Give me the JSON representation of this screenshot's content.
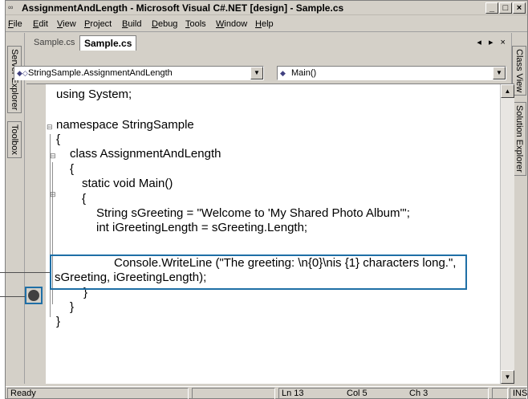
{
  "window": {
    "title": "AssignmentAndLength - Microsoft Visual C#.NET [design] - Sample.cs",
    "controls": [
      "_",
      "□",
      "×"
    ]
  },
  "menu": [
    {
      "label": "File",
      "mnemonic": "F"
    },
    {
      "label": "Edit",
      "mnemonic": "E"
    },
    {
      "label": "View",
      "mnemonic": "V"
    },
    {
      "label": "Project",
      "mnemonic": "P"
    },
    {
      "label": "Build",
      "mnemonic": "B"
    },
    {
      "label": "Debug",
      "mnemonic": "D"
    },
    {
      "label": "Tools",
      "mnemonic": "T"
    },
    {
      "label": "Window",
      "mnemonic": "W"
    },
    {
      "label": "Help",
      "mnemonic": "H"
    }
  ],
  "left_dock": {
    "tabs": [
      "Server Explorer",
      "Toolbox"
    ]
  },
  "right_dock": {
    "tabs": [
      "Class View",
      "Solution Explorer"
    ]
  },
  "doc_tabs": {
    "inactive": "Sample.cs",
    "active": "Sample.cs",
    "nav": "◂ ▸ ×"
  },
  "type_combo": {
    "value": "StringSample.AssignmentAndLength",
    "icon": "class-icon"
  },
  "member_combo": {
    "value": "Main()",
    "icon": "method-icon"
  },
  "code": [
    "using System;",
    "",
    "namespace StringSample",
    "{",
    "class AssignmentAndLength",
    "{",
    "static void Main()",
    "{",
    "String sGreeting = \"Welcome to 'My Shared Photo Album'\";",
    "int iGreetingLength = sGreeting.Length;",
    "",
    "Console.WriteLine (\"The greeting: \\n{0}\\nis {1} characters long.\",",
    "sGreeting, iGreetingLength);",
    "}",
    "}",
    "}"
  ],
  "status": {
    "ready": "Ready",
    "line": "Ln 13",
    "col": "Col 5",
    "ch": "Ch 3",
    "mode": "INS"
  },
  "colors": {
    "chrome": "#d4d0c8",
    "callout": "#1f6fa6",
    "editor_bg": "#ffffff"
  }
}
